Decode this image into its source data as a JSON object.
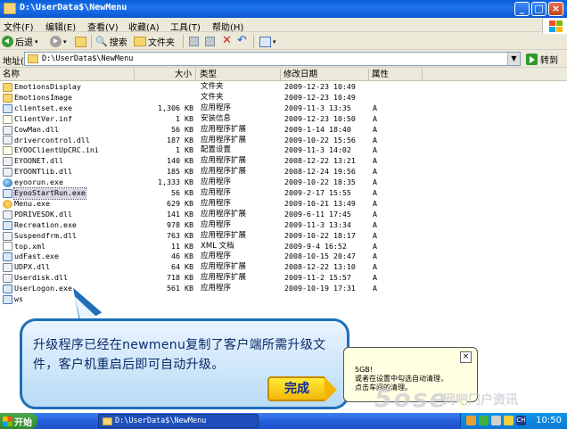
{
  "window": {
    "title": "D:\\UserData$\\NewMenu",
    "minimize_label": "_",
    "maximize_label": "□",
    "close_label": "×"
  },
  "menu": {
    "items": [
      "文件(F)",
      "编辑(E)",
      "查看(V)",
      "收藏(A)",
      "工具(T)",
      "帮助(H)"
    ]
  },
  "toolbar": {
    "back_label": "后退",
    "search_label": "搜索",
    "folders_label": "文件夹"
  },
  "address": {
    "label": "地址(D)",
    "value": "D:\\UserData$\\NewMenu",
    "go_label": "转到"
  },
  "columns": {
    "name": "名称",
    "size": "大小",
    "type": "类型",
    "date": "修改日期",
    "attr": "属性"
  },
  "files": [
    {
      "name": "EmotionsDisplay",
      "size": "",
      "type": "文件夹",
      "date": "2009-12-23 10:49",
      "attr": "",
      "icon": "folder"
    },
    {
      "name": "EmotionsImage",
      "size": "",
      "type": "文件夹",
      "date": "2009-12-23 10:49",
      "attr": "",
      "icon": "folder"
    },
    {
      "name": "clientset.exe",
      "size": "1,306 KB",
      "type": "应用程序",
      "date": "2009-11-3 13:35",
      "attr": "A",
      "icon": "exe"
    },
    {
      "name": "ClientVer.inf",
      "size": "1 KB",
      "type": "安装信息",
      "date": "2009-12-23 10:50",
      "attr": "A",
      "icon": "inf"
    },
    {
      "name": "CowMan.dll",
      "size": "56 KB",
      "type": "应用程序扩展",
      "date": "2009-1-14 18:40",
      "attr": "A",
      "icon": "dll"
    },
    {
      "name": "drivercontrol.dll",
      "size": "187 KB",
      "type": "应用程序扩展",
      "date": "2009-10-22 15:56",
      "attr": "A",
      "icon": "dll"
    },
    {
      "name": "EYOOClientUpCRC.ini",
      "size": "1 KB",
      "type": "配置设置",
      "date": "2009-11-3 14:02",
      "attr": "A",
      "icon": "inf"
    },
    {
      "name": "EYOONET.dll",
      "size": "140 KB",
      "type": "应用程序扩展",
      "date": "2008-12-22 13:21",
      "attr": "A",
      "icon": "dll"
    },
    {
      "name": "EYOONTlib.dll",
      "size": "185 KB",
      "type": "应用程序扩展",
      "date": "2008-12-24 19:56",
      "attr": "A",
      "icon": "dll"
    },
    {
      "name": "eyoorun.exe",
      "size": "1,333 KB",
      "type": "应用程序",
      "date": "2009-10-22 18:35",
      "attr": "A",
      "icon": "ball"
    },
    {
      "name": "EyooStartRun.exe",
      "size": "56 KB",
      "type": "应用程序",
      "date": "2009-2-17 15:55",
      "attr": "A",
      "icon": "exe",
      "selected": true
    },
    {
      "name": "Menu.exe",
      "size": "629 KB",
      "type": "应用程序",
      "date": "2009-10-21 13:49",
      "attr": "A",
      "icon": "star"
    },
    {
      "name": "PDRIVESDK.dll",
      "size": "141 KB",
      "type": "应用程序扩展",
      "date": "2009-6-11 17:45",
      "attr": "A",
      "icon": "dll"
    },
    {
      "name": "Recreation.exe",
      "size": "978 KB",
      "type": "应用程序",
      "date": "2009-11-3 13:34",
      "attr": "A",
      "icon": "exe"
    },
    {
      "name": "Suspendfrm.dll",
      "size": "763 KB",
      "type": "应用程序扩展",
      "date": "2009-10-22 18:17",
      "attr": "A",
      "icon": "dll"
    },
    {
      "name": "top.xml",
      "size": "11 KB",
      "type": "XML 文档",
      "date": "2009-9-4 16:52",
      "attr": "A",
      "icon": "xml"
    },
    {
      "name": "udFast.exe",
      "size": "46 KB",
      "type": "应用程序",
      "date": "2008-10-15 20:47",
      "attr": "A",
      "icon": "exe"
    },
    {
      "name": "UDPX.dll",
      "size": "64 KB",
      "type": "应用程序扩展",
      "date": "2008-12-22 13:10",
      "attr": "A",
      "icon": "dll"
    },
    {
      "name": "Userdisk.dll",
      "size": "718 KB",
      "type": "应用程序扩展",
      "date": "2009-11-2 15:57",
      "attr": "A",
      "icon": "dll"
    },
    {
      "name": "UserLogon.exe",
      "size": "561 KB",
      "type": "应用程序",
      "date": "2009-10-19 17:31",
      "attr": "A",
      "icon": "exe"
    },
    {
      "name": "ws",
      "size": "",
      "type": "",
      "date": "",
      "attr": "",
      "icon": "exe"
    }
  ],
  "callout": {
    "text": "升级程序已经在newmenu复制了客户端所需升级文件，客户机重启后即可自动升级。",
    "button_label": "完成"
  },
  "balloon": {
    "line1": "5GB!",
    "line2": "或者在设置中勾选自动清理，",
    "line3": "点击车间的清理。",
    "close_label": "×"
  },
  "watermark": {
    "text": "5ose",
    "sub": "网吧门户资讯"
  },
  "taskbar": {
    "start_label": "开始",
    "task_label": "D:\\UserData$\\NewMenu",
    "clock": "10:50"
  },
  "colors": {
    "titlebar": "#0a5fd8",
    "callout_border": "#1e6fb8",
    "button_yellow": "#f2b705"
  }
}
